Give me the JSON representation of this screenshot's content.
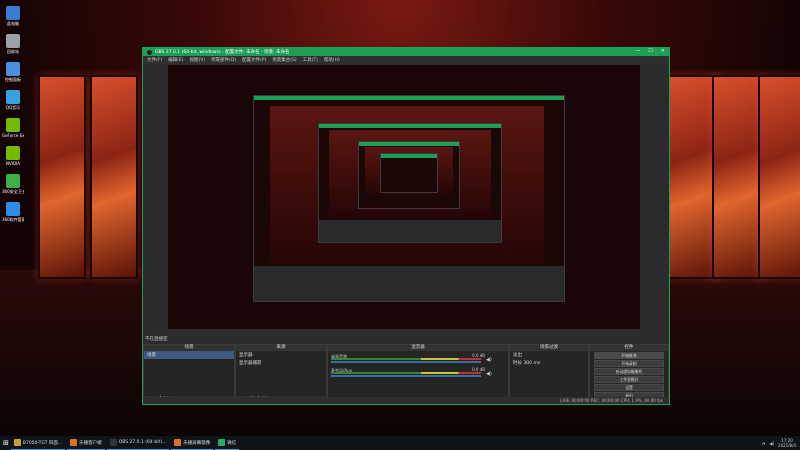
{
  "desktop": {
    "icons": [
      {
        "label": "此电脑",
        "color": "#3a7bd5"
      },
      {
        "label": "回收站",
        "color": "#9aa0a6"
      },
      {
        "label": "控制面板",
        "color": "#4a8fd8"
      },
      {
        "label": "QQ音乐",
        "color": "#36a2e0"
      },
      {
        "label": "GeForce Experience",
        "color": "#76b900"
      },
      {
        "label": "NVIDIA",
        "color": "#76b900"
      },
      {
        "label": "360安全卫士",
        "color": "#3cb043"
      },
      {
        "label": "360软件管家",
        "color": "#2e8de8"
      }
    ]
  },
  "obs": {
    "title": "OBS 27.0.1 (64-bit, windows) - 配置文件: 未命名 - 场景: 未命名",
    "window_controls": [
      "—",
      "☐",
      "✕"
    ],
    "menu": [
      "文件(F)",
      "编辑(E)",
      "视图(V)",
      "停靠部件(D)",
      "配置文件(P)",
      "场景集合(S)",
      "工具(T)",
      "帮助(H)"
    ],
    "scene_label": "不在直播室",
    "docks": {
      "scenes": {
        "header": "场景",
        "items": [
          "场景"
        ]
      },
      "sources": {
        "header": "来源",
        "items": [
          "显示器",
          "显示器捕获"
        ]
      },
      "mixer": {
        "header": "混音器",
        "channels": [
          {
            "name": "桌面音频",
            "value": "0.0 dB"
          },
          {
            "name": "麦克风/Aux",
            "value": "0.0 dB"
          }
        ]
      },
      "transitions": {
        "header": "场景过渡",
        "items": [
          "淡出",
          "时长",
          "300 ms"
        ]
      },
      "controls": {
        "header": "控件",
        "buttons": [
          "开始推流",
          "开始录制",
          "启动虚拟摄像机",
          "工作室模式",
          "设置",
          "退出"
        ]
      }
    },
    "status": "LIVE: 00:00:00   REC: 00:00:00   CPU: 1.9%, 60.00 fps"
  },
  "taskbar": {
    "items": [
      {
        "label": "B7050-TGT 四面...",
        "color": "#c8a030"
      },
      {
        "label": "乐播客户端",
        "color": "#e07020"
      },
      {
        "label": "OBS 27.0.1 (64-bit)...",
        "color": "#333333"
      },
      {
        "label": "乐播屏幕镜像",
        "color": "#e07020"
      },
      {
        "label": "微信",
        "color": "#2aae67"
      }
    ],
    "clock_time": "17:20",
    "clock_date": "2021/8/4"
  }
}
